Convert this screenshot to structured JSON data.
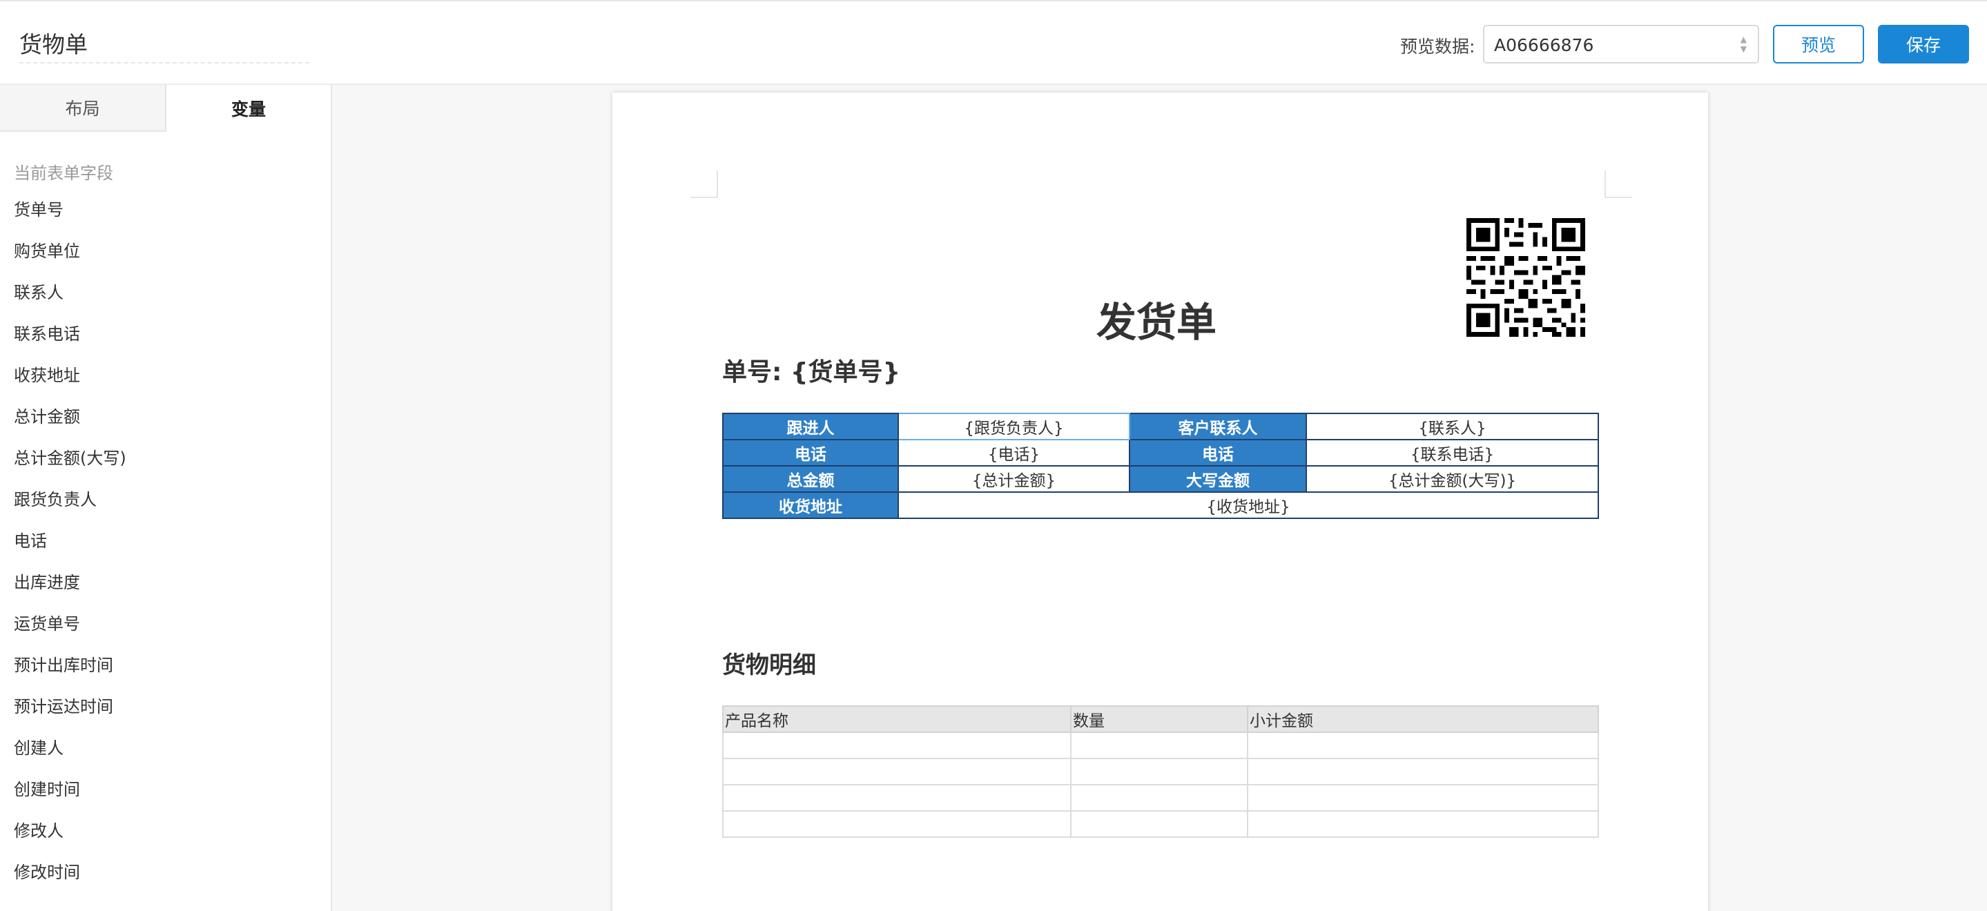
{
  "header": {
    "title": "货物单",
    "preview_label": "预览数据:",
    "preview_value": "A06666876",
    "preview_button": "预览",
    "save_button": "保存"
  },
  "sidebar": {
    "tabs": [
      {
        "label": "布局",
        "active": false
      },
      {
        "label": "变量",
        "active": true
      }
    ],
    "section_label": "当前表单字段",
    "fields": [
      "货单号",
      "购货单位",
      "联系人",
      "联系电话",
      "收获地址",
      "总计金额",
      "总计金额(大写)",
      "跟货负责人",
      "电话",
      "出库进度",
      "运货单号",
      "预计出库时间",
      "预计运达时间",
      "创建人",
      "创建时间",
      "修改人",
      "修改时间"
    ]
  },
  "document": {
    "title": "发货单",
    "number_line": "单号: {货单号}",
    "qr_icon": "qr-code-icon",
    "info_table": {
      "row1": {
        "h1": "跟进人",
        "v1": "{跟货负责人}",
        "h2": "客户联系人",
        "v2": "{联系人}"
      },
      "row2": {
        "h1": "电话",
        "v1": "{电话}",
        "h2": "电话",
        "v2": "{联系电话}"
      },
      "row3": {
        "h1": "总金额",
        "v1": "{总计金额}",
        "h2": "大写金额",
        "v2": "{总计金额(大写)}"
      },
      "row4": {
        "h1": "收货地址",
        "v1": "{收货地址}"
      }
    },
    "detail_title": "货物明细",
    "detail_table": {
      "columns": [
        "产品名称",
        "数量",
        "小计金额"
      ]
    }
  },
  "colors": {
    "accent": "#1a87d6",
    "table_header": "#2f7fc6",
    "table_border": "#1f3f6b"
  }
}
